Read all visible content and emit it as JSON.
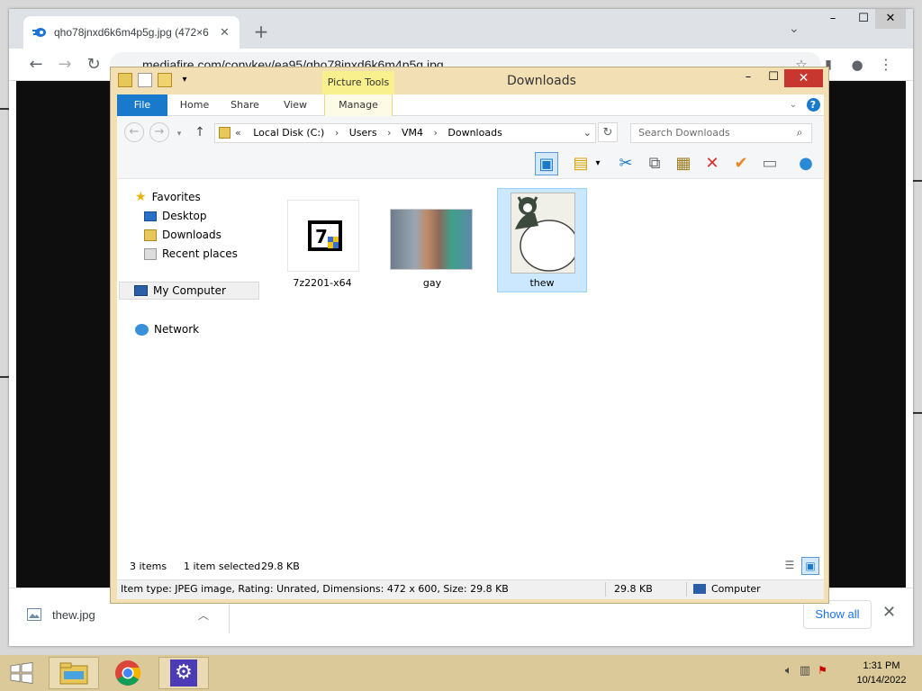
{
  "browser": {
    "tab_title": "qho78jnxd6k6m4p5g.jpg (472×6",
    "url": "mediafire.com/convkey/ea95/qho78jnxd6k6m4p5g.jpg",
    "download_file": "thew.jpg",
    "show_all": "Show all"
  },
  "explorer": {
    "title": "Downloads",
    "contextual_tab": "Picture Tools",
    "tabs": [
      "File",
      "Home",
      "Share",
      "View",
      "Manage"
    ],
    "breadcrumb": [
      "Local Disk (C:)",
      "Users",
      "VM4",
      "Downloads"
    ],
    "breadcrumb_prefix": "«",
    "search_placeholder": "Search Downloads",
    "nav": {
      "favorites": "Favorites",
      "desktop": "Desktop",
      "downloads": "Downloads",
      "recent": "Recent places",
      "computer": "My Computer",
      "network": "Network"
    },
    "files": [
      {
        "name": "7z2201-x64"
      },
      {
        "name": "gay"
      },
      {
        "name": "thew"
      }
    ],
    "status": {
      "count": "3 items",
      "selected": "1 item selected",
      "size": "29.8 KB"
    },
    "details": {
      "info": "Item type: JPEG image, Rating: Unrated, Dimensions: 472 x 600, Size: 29.8 KB",
      "size": "29.8 KB",
      "location": "Computer"
    }
  },
  "taskbar": {
    "time": "1:31 PM",
    "date": "10/14/2022"
  },
  "colors": {
    "window_frame": "#f2e0b4",
    "file_tab": "#1979ca",
    "selection": "#cce8ff",
    "close": "#c7372f",
    "taskbar": "#dcc99a"
  }
}
